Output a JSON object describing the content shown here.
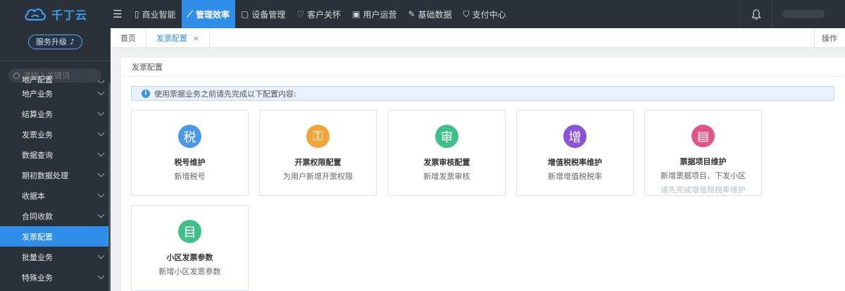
{
  "brand": {
    "name": "千丁云",
    "color": "#3d9df2"
  },
  "topnav": {
    "items": [
      {
        "label": "商业智能",
        "icon": "chart-doc-icon"
      },
      {
        "label": "管理效率",
        "icon": "line-chart-icon",
        "active": true
      },
      {
        "label": "设备管理",
        "icon": "device-icon"
      },
      {
        "label": "客户关怀",
        "icon": "heart-icon"
      },
      {
        "label": "用户运营",
        "icon": "user-card-icon"
      },
      {
        "label": "基础数据",
        "icon": "wrench-icon"
      },
      {
        "label": "支付中心",
        "icon": "shield-icon"
      }
    ]
  },
  "sidebar": {
    "upgrade_label": "服务升级",
    "search_placeholder": "请输入关键词",
    "items": [
      {
        "label": "地产配置"
      },
      {
        "label": "地产业务"
      },
      {
        "label": "结算业务"
      },
      {
        "label": "发票业务"
      },
      {
        "label": "数据查询"
      },
      {
        "label": "期初数据处理"
      },
      {
        "label": "收据本"
      },
      {
        "label": "合同收款"
      },
      {
        "label": "发票配置",
        "active": true
      },
      {
        "label": "批量业务"
      },
      {
        "label": "特殊业务"
      }
    ]
  },
  "tabs": {
    "items": [
      {
        "label": "首页"
      },
      {
        "label": "发票配置",
        "active": true,
        "closable": true
      }
    ],
    "ops_label": "操作"
  },
  "page": {
    "title": "发票配置",
    "notice": "使用票据业务之前请先完成以下配置内容:"
  },
  "cards": [
    {
      "icon_char": "税",
      "icon_color": "#4b97e8",
      "title": "税号维护",
      "desc": "新增税号"
    },
    {
      "icon_char": "⚿",
      "icon_color": "#f0a43a",
      "title": "开票权限配置",
      "desc": "为用户新增开票权限"
    },
    {
      "icon_char": "审",
      "icon_color": "#3fbf8a",
      "title": "发票审核配置",
      "desc": "新增发票审核"
    },
    {
      "icon_char": "增",
      "icon_color": "#8a55d6",
      "title": "增值税税率维护",
      "desc": "新增增值税税率"
    },
    {
      "icon_char": "▤",
      "icon_color": "#e0548a",
      "title": "票据项目维护",
      "desc": "新增票据项目、下发小区",
      "warn": "请先完成增值税税率维护"
    },
    {
      "icon_char": "目",
      "icon_color": "#3fbf8a",
      "title": "小区发票参数",
      "desc": "新增小区发票参数"
    }
  ]
}
